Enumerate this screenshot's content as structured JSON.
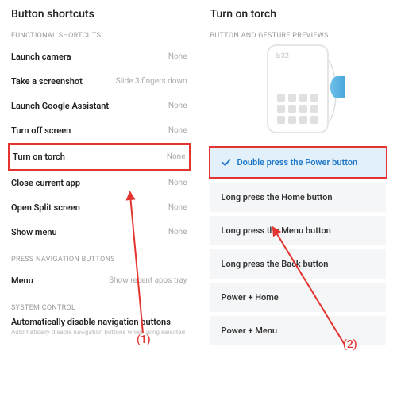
{
  "left": {
    "title": "Button shortcuts",
    "section1": "FUNCTIONAL SHORTCUTS",
    "items": [
      {
        "label": "Launch camera",
        "value": "None"
      },
      {
        "label": "Take a screenshot",
        "value": "Slide 3 fingers down"
      },
      {
        "label": "Launch Google Assistant",
        "value": "None"
      },
      {
        "label": "Turn off screen",
        "value": "None"
      },
      {
        "label": "Turn on torch",
        "value": "None"
      },
      {
        "label": "Close current app",
        "value": "None"
      },
      {
        "label": "Open Split screen",
        "value": "None"
      },
      {
        "label": "Show menu",
        "value": "None"
      }
    ],
    "section2": "PRESS NAVIGATION BUTTONS",
    "menu_label": "Menu",
    "menu_value": "Show recent apps tray",
    "section3": "SYSTEM CONTROL",
    "auto_title": "Automatically disable navigation buttons",
    "auto_sub": "Automatically disable navigation buttons when using selected"
  },
  "right": {
    "title": "Turn on torch",
    "section": "BUTTON AND GESTURE PREVIEWS",
    "phone_time": "6:32",
    "options": [
      "Double press the Power button",
      "Long press the Home button",
      "Long press the Menu button",
      "Long press the Back button",
      "Power + Home",
      "Power + Menu"
    ]
  },
  "annotations": {
    "step1": "(1)",
    "step2": "(2)"
  }
}
